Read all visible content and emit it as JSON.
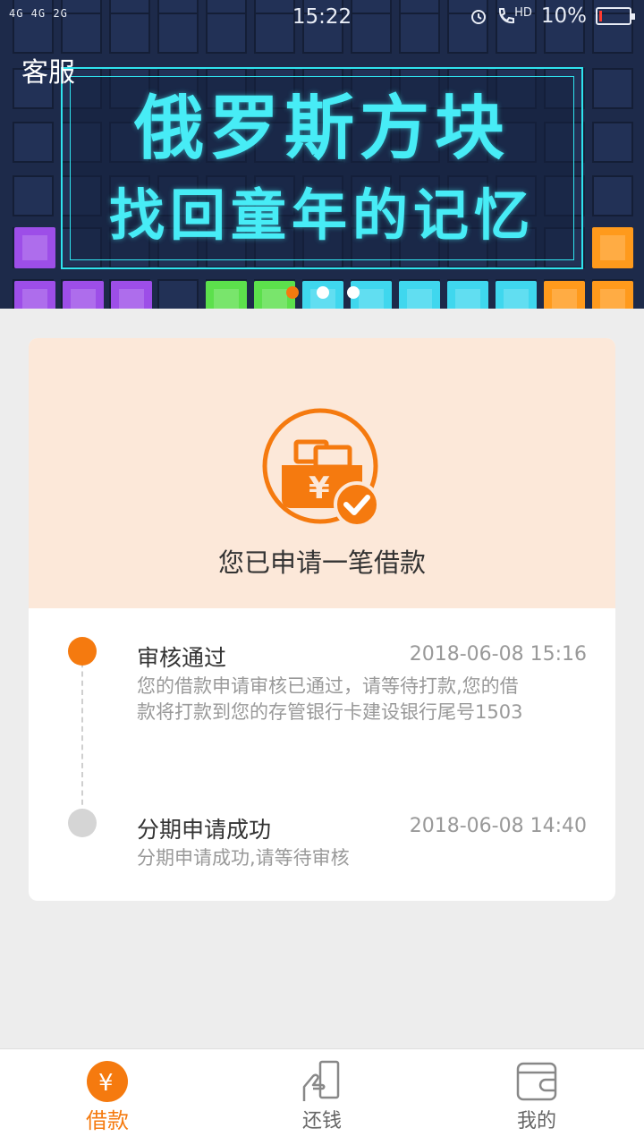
{
  "status_bar": {
    "signal": "4G 4G 2G",
    "time": "15:22",
    "battery": "10%",
    "battery_level": 0.1,
    "icons": [
      "alarm-icon",
      "call-hd-icon",
      "battery-icon"
    ],
    "hd": "HD"
  },
  "banner": {
    "service_label": "客服",
    "title_line1": "俄罗斯方块",
    "title_line2": "找回童年的记忆",
    "page_indicator": {
      "count": 3,
      "active": 0
    }
  },
  "loan_card": {
    "icon": "yuan-wallet-check-icon",
    "message": "您已申请一笔借款",
    "yuan_symbol": "¥"
  },
  "timeline": [
    {
      "title": "审核通过",
      "time": "2018-06-08 15:16",
      "desc_line1": "您的借款申请审核已通过，请等待打款,您的借",
      "desc_line2": "款将打款到您的存管银行卡建设银行尾号1503",
      "status": "done"
    },
    {
      "title": "分期申请成功",
      "time": "2018-06-08 14:40",
      "desc_line1": "分期申请成功,请等待审核",
      "status": "past"
    }
  ],
  "tab_bar": {
    "items": [
      {
        "label": "借款",
        "icon": "yuan-coin-icon",
        "active": true
      },
      {
        "label": "还钱",
        "icon": "hand-card-icon",
        "active": false
      },
      {
        "label": "我的",
        "icon": "wallet-icon",
        "active": false
      }
    ],
    "yuan_symbol": "¥"
  },
  "colors": {
    "accent": "#f57a0f",
    "banner_bg": "#1d2a4a",
    "banner_text": "#47ecf6",
    "card_header_bg": "#fce8d9",
    "page_bg": "#ededed"
  }
}
